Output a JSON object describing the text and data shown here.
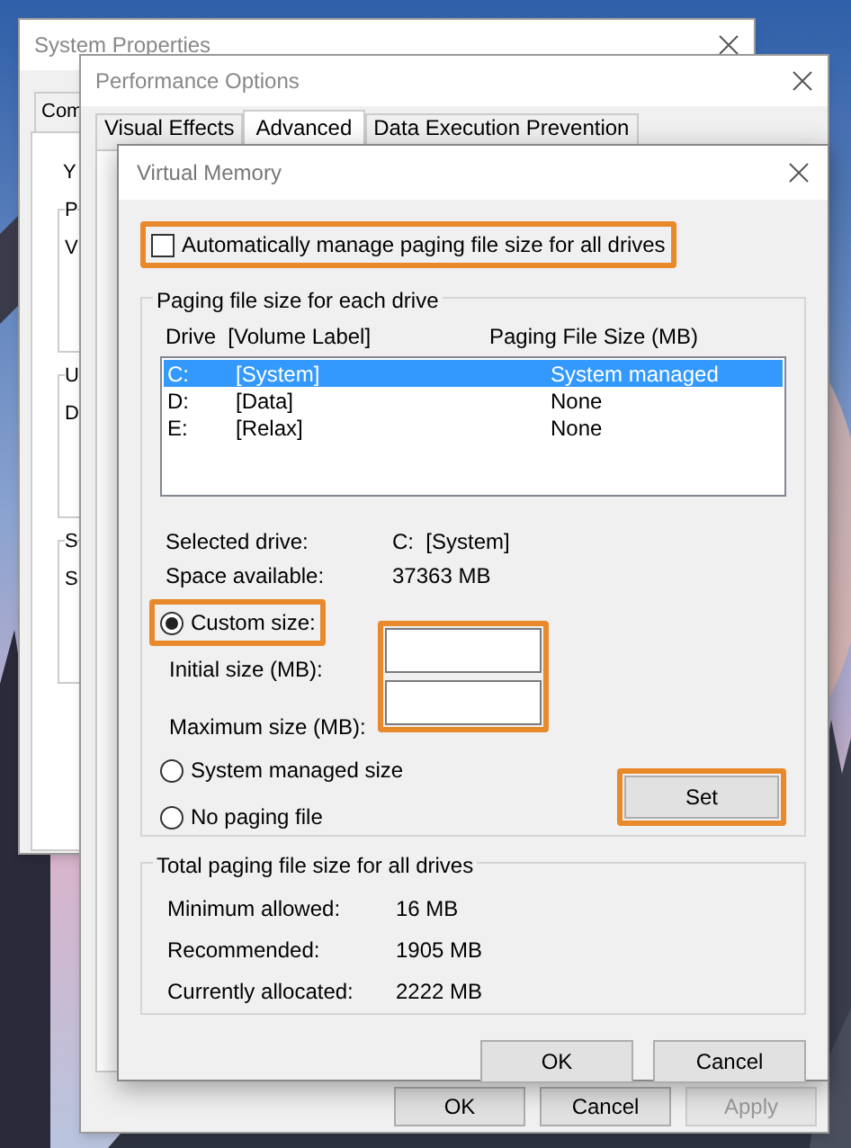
{
  "system_properties": {
    "title": "System Properties",
    "tab": "Com",
    "intro": "Y",
    "groups": [
      {
        "legend": "P",
        "line": "V"
      },
      {
        "legend": "U",
        "line": "D"
      },
      {
        "legend": "S",
        "line": "S"
      }
    ]
  },
  "performance_options": {
    "title": "Performance Options",
    "tabs": [
      {
        "label": "Visual Effects",
        "selected": false
      },
      {
        "label": "Advanced",
        "selected": true
      },
      {
        "label": "Data Execution Prevention",
        "selected": false
      }
    ],
    "buttons": [
      {
        "label": "OK",
        "disabled": false
      },
      {
        "label": "Cancel",
        "disabled": false
      },
      {
        "label": "Apply",
        "disabled": true
      }
    ]
  },
  "virtual_memory": {
    "title": "Virtual Memory",
    "auto_manage": {
      "label": "Automatically manage paging file size for all drives",
      "checked": false,
      "highlighted": true
    },
    "drives_group": {
      "legend": "Paging file size for each drive",
      "columns": [
        "Drive  [Volume Label]",
        "Paging File Size (MB)"
      ],
      "rows": [
        {
          "drive": "C:",
          "label": "[System]",
          "size": "System managed",
          "selected": true
        },
        {
          "drive": "D:",
          "label": "[Data]",
          "size": "None",
          "selected": false
        },
        {
          "drive": "E:",
          "label": "[Relax]",
          "size": "None",
          "selected": false
        }
      ],
      "info": [
        {
          "label": "Selected drive:",
          "value": "C:  [System]"
        },
        {
          "label": "Space available:",
          "value": "37363 MB"
        }
      ],
      "custom": {
        "label": "Custom size:",
        "selected": true,
        "highlighted": true
      },
      "fields": [
        {
          "label": "Initial size (MB):"
        },
        {
          "label": "Maximum size (MB):"
        }
      ],
      "fields_highlighted": true,
      "other_options": [
        {
          "label": "System managed size",
          "selected": false
        },
        {
          "label": "No paging file",
          "selected": false
        }
      ],
      "set_button": {
        "label": "Set",
        "highlighted": true
      }
    },
    "total_group": {
      "legend": "Total paging file size for all drives",
      "rows": [
        {
          "label": "Minimum allowed:",
          "value": "16 MB"
        },
        {
          "label": "Recommended:",
          "value": "1905 MB"
        },
        {
          "label": "Currently allocated:",
          "value": "2222 MB"
        }
      ]
    },
    "buttons": [
      {
        "label": "OK"
      },
      {
        "label": "Cancel"
      }
    ]
  }
}
